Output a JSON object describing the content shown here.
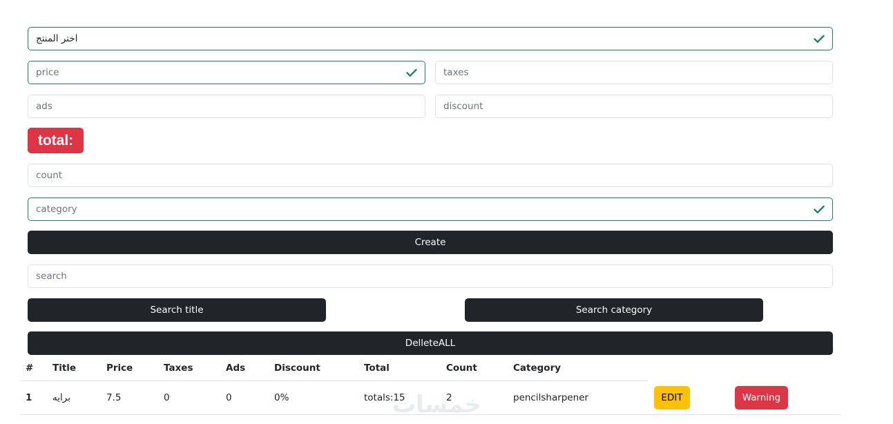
{
  "form": {
    "product_value": "اختر المنتج",
    "price_placeholder": "price",
    "taxes_placeholder": "taxes",
    "ads_placeholder": "ads",
    "discount_placeholder": "discount",
    "total_label": "total:",
    "count_placeholder": "count",
    "category_placeholder": "category",
    "create_label": "Create",
    "search_placeholder": "search",
    "search_title_label": "Search title",
    "search_category_label": "Search category",
    "delete_all_label": "DelleteALL"
  },
  "table": {
    "headers": [
      "#",
      "Title",
      "Price",
      "Taxes",
      "Ads",
      "Discount",
      "Total",
      "Count",
      "Category"
    ],
    "rows": [
      {
        "id": "1",
        "title": "برايه",
        "price": "7.5",
        "taxes": "0",
        "ads": "0",
        "discount": "0%",
        "total": "totals:15",
        "count": "2",
        "category": "pencilsharpener",
        "edit_label": "EDIT",
        "warning_label": "Warning"
      }
    ]
  },
  "watermark": "خمسات",
  "colors": {
    "dark": "#212529",
    "danger": "#dc3545",
    "warning": "#ffc107",
    "valid": "#198754"
  }
}
